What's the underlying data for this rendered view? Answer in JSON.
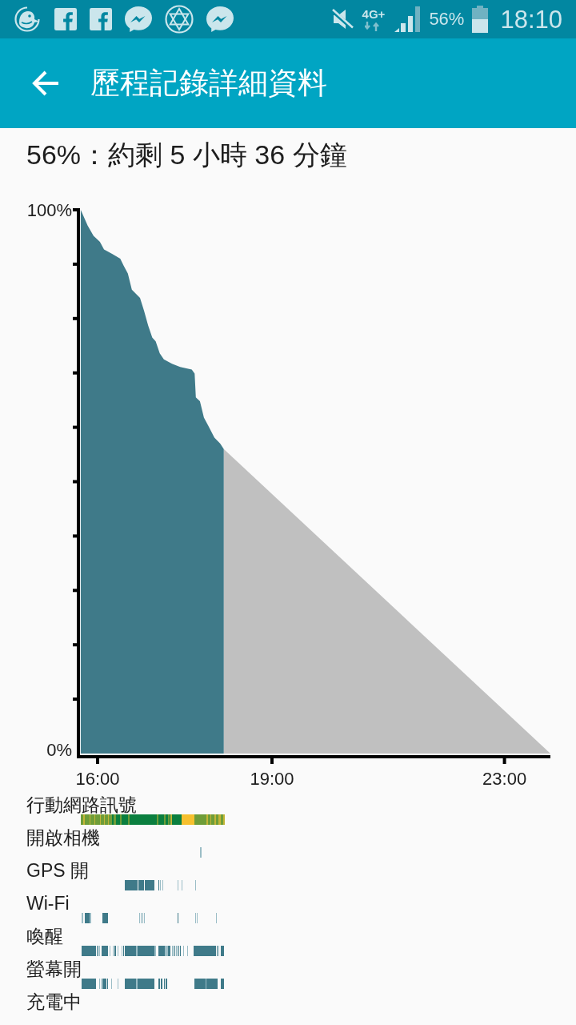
{
  "status_bar": {
    "network": "4G+",
    "battery": "56%",
    "time": "18:10"
  },
  "app_bar": {
    "title": "歷程記錄詳細資料"
  },
  "summary": "56%：約剩 5 小時 36 分鐘",
  "battery_chart": {
    "chart_data": {
      "type": "area",
      "x": [
        15.71,
        15.83,
        15.93,
        16.04,
        16.11,
        16.25,
        16.39,
        16.45,
        16.52,
        16.59,
        16.73,
        16.8,
        16.87,
        16.94,
        17.0,
        17.07,
        17.14,
        17.28,
        17.42,
        17.62,
        17.67,
        17.69,
        17.76,
        17.83,
        17.9,
        18.01,
        18.11,
        18.17,
        23.79
      ],
      "series": [
        {
          "color": "#3f7a89",
          "values": [
            100,
            97.1,
            95.2,
            94.1,
            92.7,
            91.9,
            91,
            89.7,
            88.3,
            85.3,
            83.8,
            81.4,
            78.7,
            76.5,
            75.8,
            73.6,
            72.5,
            71.7,
            71.1,
            70.6,
            69.9,
            65.5,
            64.8,
            61.8,
            60.4,
            58.1,
            57,
            56,
            null
          ]
        },
        {
          "color": "#c0c0c0",
          "values": [
            null,
            null,
            null,
            null,
            null,
            null,
            null,
            null,
            null,
            null,
            null,
            null,
            null,
            null,
            null,
            null,
            null,
            null,
            null,
            null,
            null,
            null,
            null,
            null,
            null,
            null,
            null,
            56,
            0
          ]
        }
      ],
      "xlim": [
        15.67,
        23.79
      ],
      "ylim": [
        0,
        100
      ],
      "xticks": [
        {
          "value": 16,
          "label": "16:00"
        },
        {
          "value": 19,
          "label": "19:00"
        },
        {
          "value": 23,
          "label": "23:00"
        }
      ],
      "yticks": [
        {
          "value": 0,
          "label": "0%"
        },
        {
          "value": 100,
          "label": "100%"
        }
      ]
    }
  },
  "activity_rows": [
    {
      "label": "行動網路訊號",
      "kind": "signal"
    },
    {
      "label": "開啟相機",
      "kind": "events"
    },
    {
      "label": "GPS 開",
      "kind": "events"
    },
    {
      "label": "Wi-Fi",
      "kind": "events"
    },
    {
      "label": "喚醒",
      "kind": "events"
    },
    {
      "label": "螢幕開",
      "kind": "events"
    },
    {
      "label": "充電中",
      "kind": "events"
    }
  ]
}
